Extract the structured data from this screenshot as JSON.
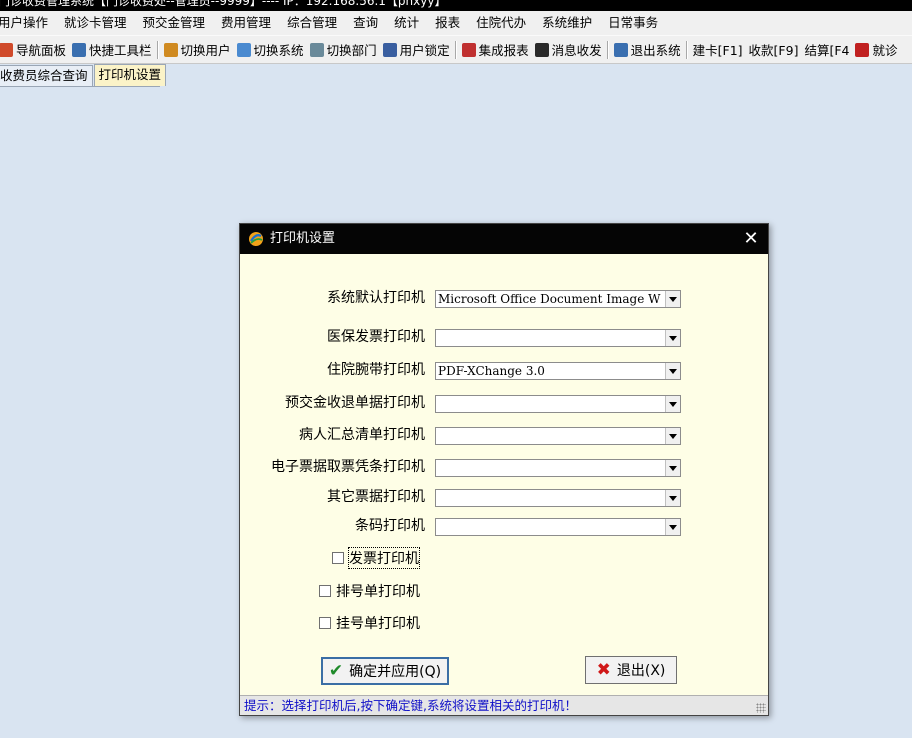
{
  "window": {
    "title": "门诊收费管理系统【门诊收费处--管理员--9999】---- IP：192.168.56.1【pnxyy】"
  },
  "menubar": {
    "items": [
      "用户操作",
      "就诊卡管理",
      "预交金管理",
      "费用管理",
      "综合管理",
      "查询",
      "统计",
      "报表",
      "住院代办",
      "系统维护",
      "日常事务"
    ]
  },
  "toolbar": {
    "items": [
      {
        "label": "导航面板",
        "icon": "dashboard-icon",
        "color": "#d04a2a"
      },
      {
        "label": "快捷工具栏",
        "icon": "toolbar-icon",
        "color": "#3a6fb0"
      },
      {
        "label": "切换用户",
        "icon": "users-icon",
        "color": "#d08a20"
      },
      {
        "label": "切换系统",
        "icon": "switch-icon",
        "color": "#4a8ad0"
      },
      {
        "label": "切换部门",
        "icon": "department-icon",
        "color": "#6a8a9a"
      },
      {
        "label": "用户锁定",
        "icon": "user-lock-icon",
        "color": "#3a5fa0"
      },
      {
        "label": "集成报表",
        "icon": "report-icon",
        "color": "#c03030"
      },
      {
        "label": "消息收发",
        "icon": "info-icon",
        "color": "#2a2a2a"
      },
      {
        "label": "退出系统",
        "icon": "exit-icon",
        "color": "#3a6fb0"
      },
      {
        "label": "建卡[F1]",
        "icon": "",
        "color": ""
      },
      {
        "label": "收款[F9]",
        "icon": "",
        "color": ""
      },
      {
        "label": "结算[F4",
        "icon": "",
        "color": ""
      },
      {
        "label": "就诊",
        "icon": "print-icon",
        "color": "#c02020"
      }
    ]
  },
  "tabs": [
    {
      "label": "收费员综合查询",
      "active": false
    },
    {
      "label": "打印机设置",
      "active": true
    }
  ],
  "dialog": {
    "title": "打印机设置",
    "close_symbol": "✕",
    "printers": [
      {
        "label": "系统默认打印机",
        "value": "Microsoft Office Document Image W"
      },
      {
        "label": "医保发票打印机",
        "value": ""
      },
      {
        "label": "住院腕带打印机",
        "value": "PDF-XChange 3.0"
      },
      {
        "label": "预交金收退单据打印机",
        "value": ""
      },
      {
        "label": "病人汇总清单打印机",
        "value": ""
      },
      {
        "label": "电子票据取票凭条打印机",
        "value": ""
      },
      {
        "label": "其它票据打印机",
        "value": ""
      },
      {
        "label": "条码打印机",
        "value": ""
      }
    ],
    "checkboxes": [
      {
        "label": "发票打印机",
        "checked": false
      },
      {
        "label": "排号单打印机",
        "checked": false
      },
      {
        "label": "挂号单打印机",
        "checked": false
      }
    ],
    "ok_label": "确定并应用(Q)",
    "exit_label": "退出(X)",
    "status": "提示：选择打印机后,按下确定键,系统将设置相关的打印机！"
  }
}
